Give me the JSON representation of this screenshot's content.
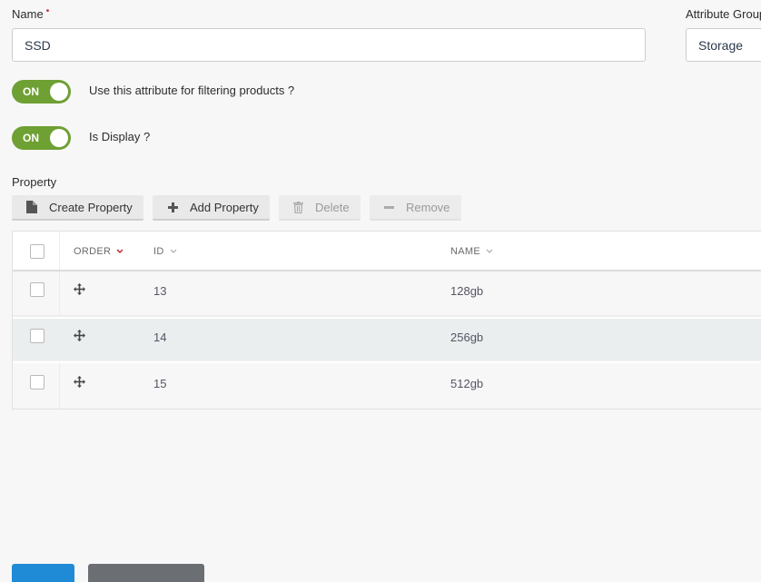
{
  "form": {
    "name_label": "Name",
    "required_mark": "•",
    "name_value": "SSD",
    "group_label": "Attribute Group",
    "group_value": "Storage"
  },
  "toggles": [
    {
      "state": "ON",
      "label": "Use this attribute for filtering products ?"
    },
    {
      "state": "ON",
      "label": "Is Display ?"
    }
  ],
  "property": {
    "section_label": "Property",
    "buttons": {
      "create": "Create Property",
      "add": "Add Property",
      "delete": "Delete",
      "remove": "Remove"
    },
    "columns": {
      "order": "ORDER",
      "id": "ID",
      "name": "NAME"
    },
    "rows": [
      {
        "id": "13",
        "name": "128gb"
      },
      {
        "id": "14",
        "name": "256gb"
      },
      {
        "id": "15",
        "name": "512gb"
      }
    ]
  },
  "colors": {
    "toggle_on": "#6fa033",
    "primary": "#1f8bd6",
    "secondary": "#6b6e72",
    "sort_active": "#c0202a"
  }
}
